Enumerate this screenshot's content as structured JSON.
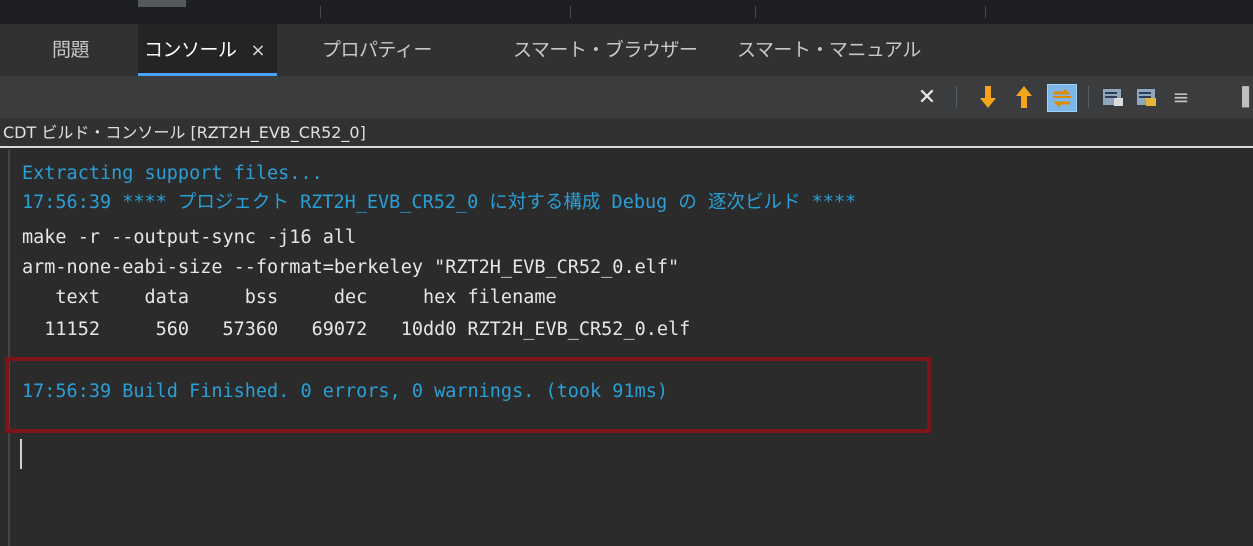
{
  "tabs": [
    {
      "label": "問題"
    },
    {
      "label": "コンソール",
      "close": "×"
    },
    {
      "label": "プロパティー"
    },
    {
      "label": "スマート・ブラウザー"
    },
    {
      "label": "スマート・マニュアル"
    }
  ],
  "toolbar": {
    "icons": [
      "close-icon",
      "scroll-down-arrow-icon",
      "scroll-up-arrow-icon",
      "link-toggle-icon",
      "console-menu-icon",
      "pin-console-icon",
      "word-wrap-icon"
    ]
  },
  "console": {
    "title": "CDT ビルド・コンソール [RZT2H_EVB_CR52_0]",
    "lines": [
      {
        "text": "Extracting support files...",
        "color": "#2a9fd6"
      },
      {
        "text": "17:56:39 **** プロジェクト RZT2H_EVB_CR52_0 に対する構成 Debug の 逐次ビルド ****",
        "color": "#2a9fd6"
      },
      {
        "text": "make -r --output-sync -j16 all",
        "color": "#e6e6e6"
      },
      {
        "text": "arm-none-eabi-size --format=berkeley \"RZT2H_EVB_CR52_0.elf\"",
        "color": "#e6e6e6"
      },
      {
        "text": "   text    data     bss     dec     hex filename",
        "color": "#e6e6e6"
      },
      {
        "text": "  11152     560   57360   69072   10dd0 RZT2H_EVB_CR52_0.elf",
        "color": "#e6e6e6"
      },
      {
        "text": "",
        "color": "#e6e6e6"
      },
      {
        "text": "17:56:39 Build Finished. 0 errors, 0 warnings. (took 91ms)",
        "color": "#2a9fd6"
      }
    ]
  },
  "highlight_color": "#7c1419"
}
